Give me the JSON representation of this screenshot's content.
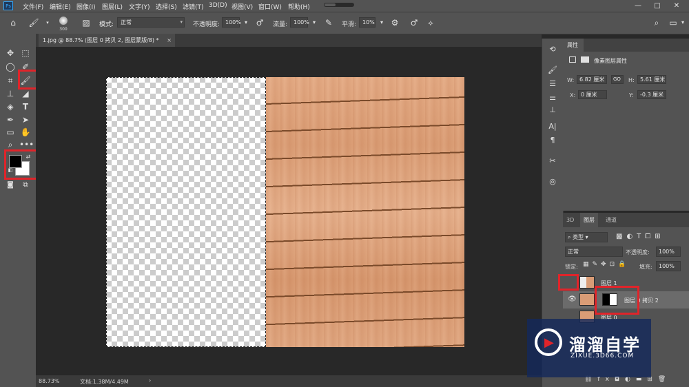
{
  "app": {
    "logo_text": "Ps"
  },
  "menubar": {
    "items": [
      "文件(F)",
      "编辑(E)",
      "图像(I)",
      "图层(L)",
      "文字(Y)",
      "选择(S)",
      "滤镜(T)",
      "3D(D)",
      "视图(V)",
      "窗口(W)",
      "帮助(H)"
    ],
    "window_controls": [
      "—",
      "□",
      "✕"
    ]
  },
  "optionsbar": {
    "brush_size": "300",
    "mode_label": "模式:",
    "mode_value": "正常",
    "opacity_label": "不透明度:",
    "opacity_value": "100%",
    "flow_label": "流量:",
    "flow_value": "100%",
    "smoothing_label": "平滑:",
    "smoothing_value": "10%"
  },
  "document": {
    "tab_title": "1.jpg @ 88.7% (图层 0 拷贝 2, 图层蒙版/8) *",
    "tab_close": "×"
  },
  "statusbar": {
    "zoom": "88.73%",
    "doc_info": "文档:1.38M/4.49M",
    "arrow": "›"
  },
  "properties": {
    "tab_label": "属性",
    "title": "像素图层属性",
    "w_label": "W:",
    "w_value": "6.82 厘米",
    "h_label": "H:",
    "h_value": "5.61 厘米",
    "x_label": "X:",
    "x_value": "0 厘米",
    "y_label": "Y:",
    "y_value": "-0.3 厘米",
    "link_icon": "GO"
  },
  "layers": {
    "tabs": [
      "3D",
      "图层",
      "通道"
    ],
    "filter_label": "类型",
    "blend_mode": "正常",
    "opacity_label": "不透明度:",
    "opacity_value": "100%",
    "lock_label": "锁定:",
    "fill_label": "填充:",
    "fill_value": "100%",
    "rows": [
      {
        "name": "图层 1"
      },
      {
        "name": "图层 0 拷贝 2"
      },
      {
        "name": "图层 0"
      }
    ]
  },
  "watermark": {
    "title": "溜溜自学",
    "subtitle": "ZIXUE.3D66.COM"
  },
  "colors": {
    "highlight": "#e0242a",
    "panel": "#535353",
    "canvas_bg": "#282828"
  }
}
